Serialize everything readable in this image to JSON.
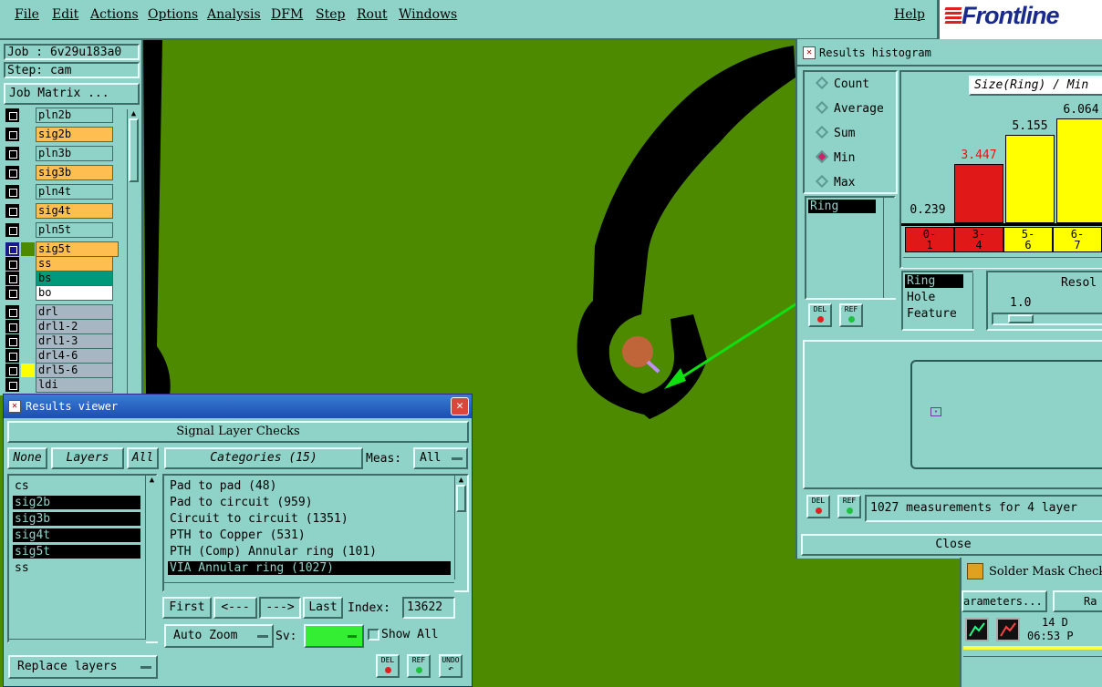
{
  "menu": {
    "items": [
      "File",
      "Edit",
      "Actions",
      "Options",
      "Analysis",
      "DFM",
      "Step",
      "Rout",
      "Windows"
    ],
    "help": "Help",
    "brand": "Frontline"
  },
  "job": {
    "job_label": "Job : 6v29u183a0",
    "step_label": "Step: cam",
    "matrix_button": "Job Matrix ..."
  },
  "layers": [
    {
      "name": "pln2b",
      "color": "#8fd2c8"
    },
    {
      "name": "sig2b",
      "color": "#ffbf50"
    },
    {
      "name": "pln3b",
      "color": "#8fd2c8"
    },
    {
      "name": "sig3b",
      "color": "#ffbf50"
    },
    {
      "name": "pln4t",
      "color": "#8fd2c8"
    },
    {
      "name": "sig4t",
      "color": "#ffbf50"
    },
    {
      "name": "pln5t",
      "color": "#8fd2c8"
    },
    {
      "name": "sig5t",
      "color": "#ffbf50"
    },
    {
      "name": "ss",
      "color": "#ffbf50"
    },
    {
      "name": "bs",
      "color": "#00997a"
    },
    {
      "name": "bo",
      "color": "#ffffff"
    },
    {
      "name": "drl",
      "color": "#a6b7c3"
    },
    {
      "name": "drl1-2",
      "color": "#a6b7c3"
    },
    {
      "name": "drl1-3",
      "color": "#a6b7c3"
    },
    {
      "name": "drl4-6",
      "color": "#a6b7c3"
    },
    {
      "name": "drl5-6",
      "color": "#a6b7c3"
    },
    {
      "name": "ldi",
      "color": "#a6b7c3"
    }
  ],
  "results_viewer": {
    "title": "Results viewer",
    "section_title": "Signal Layer Checks",
    "none_button": "None",
    "layers_button": "Layers",
    "all_button": "All",
    "categories_button": "Categories (15)",
    "meas_label": "Meas:",
    "meas_value": "All",
    "layer_list": [
      {
        "name": "cs",
        "selected": false
      },
      {
        "name": "sig2b",
        "selected": true
      },
      {
        "name": "sig3b",
        "selected": true
      },
      {
        "name": "sig4t",
        "selected": true
      },
      {
        "name": "sig5t",
        "selected": true
      },
      {
        "name": "ss",
        "selected": false
      }
    ],
    "categories": [
      {
        "name": "Pad to pad (48)",
        "selected": false
      },
      {
        "name": "Pad to circuit (959)",
        "selected": false
      },
      {
        "name": "Circuit to circuit (1351)",
        "selected": false
      },
      {
        "name": "PTH to Copper (531)",
        "selected": false
      },
      {
        "name": "PTH (Comp) Annular ring (101)",
        "selected": false
      },
      {
        "name": "VIA Annular ring (1027)",
        "selected": true
      }
    ],
    "first_button": "First",
    "prev_button": "<---",
    "next_button": "--->",
    "last_button": "Last",
    "index_label": "Index:",
    "index_value": "13622",
    "auto_zoom": "Auto Zoom",
    "sv_label": "Sv:",
    "show_all": "Show All",
    "replace_layers": "Replace layers",
    "del_label": "DEL",
    "ref_label": "REF",
    "undo_label": "UNDO"
  },
  "histogram": {
    "title": "Results histogram",
    "radios": [
      {
        "label": "Count",
        "on": false
      },
      {
        "label": "Average",
        "on": false
      },
      {
        "label": "Sum",
        "on": false
      },
      {
        "label": "Min",
        "on": true
      },
      {
        "label": "Max",
        "on": false
      }
    ],
    "ring_list_item": "Ring",
    "chart_title": "Size(Ring) / Min",
    "chart_data": {
      "type": "bar",
      "categories": [
        "0-1",
        "3-4",
        "5-6",
        "6-7"
      ],
      "values": [
        0.239,
        3.447,
        5.155,
        6.064
      ],
      "colors": [
        "#8fd2c8",
        "#e01818",
        "#ffff00",
        "#ffff00"
      ],
      "label_colors": [
        "#000000",
        "#e01818",
        "#000000",
        "#000000"
      ]
    },
    "bins": [
      {
        "top": "0-",
        "bottom": "1",
        "color": "#e01818"
      },
      {
        "top": "3-",
        "bottom": "4",
        "color": "#e01818"
      },
      {
        "top": "5-",
        "bottom": "6",
        "color": "#ffff00"
      },
      {
        "top": "6-",
        "bottom": "7",
        "color": "#ffff00"
      }
    ],
    "attr_list": [
      "Ring",
      "Hole",
      "Feature"
    ],
    "resolution_label": "Resol",
    "resolution_value": "1.0",
    "status": "1027 measurements for 4 layer",
    "close_button": "Close",
    "del_label": "DEL",
    "ref_label": "REF"
  },
  "solder_mask": {
    "title": "Solder Mask Checks",
    "params_button": "arameters...",
    "range_button": "Ra",
    "date_line1": "14 D",
    "date_line2": "06:53 P"
  }
}
